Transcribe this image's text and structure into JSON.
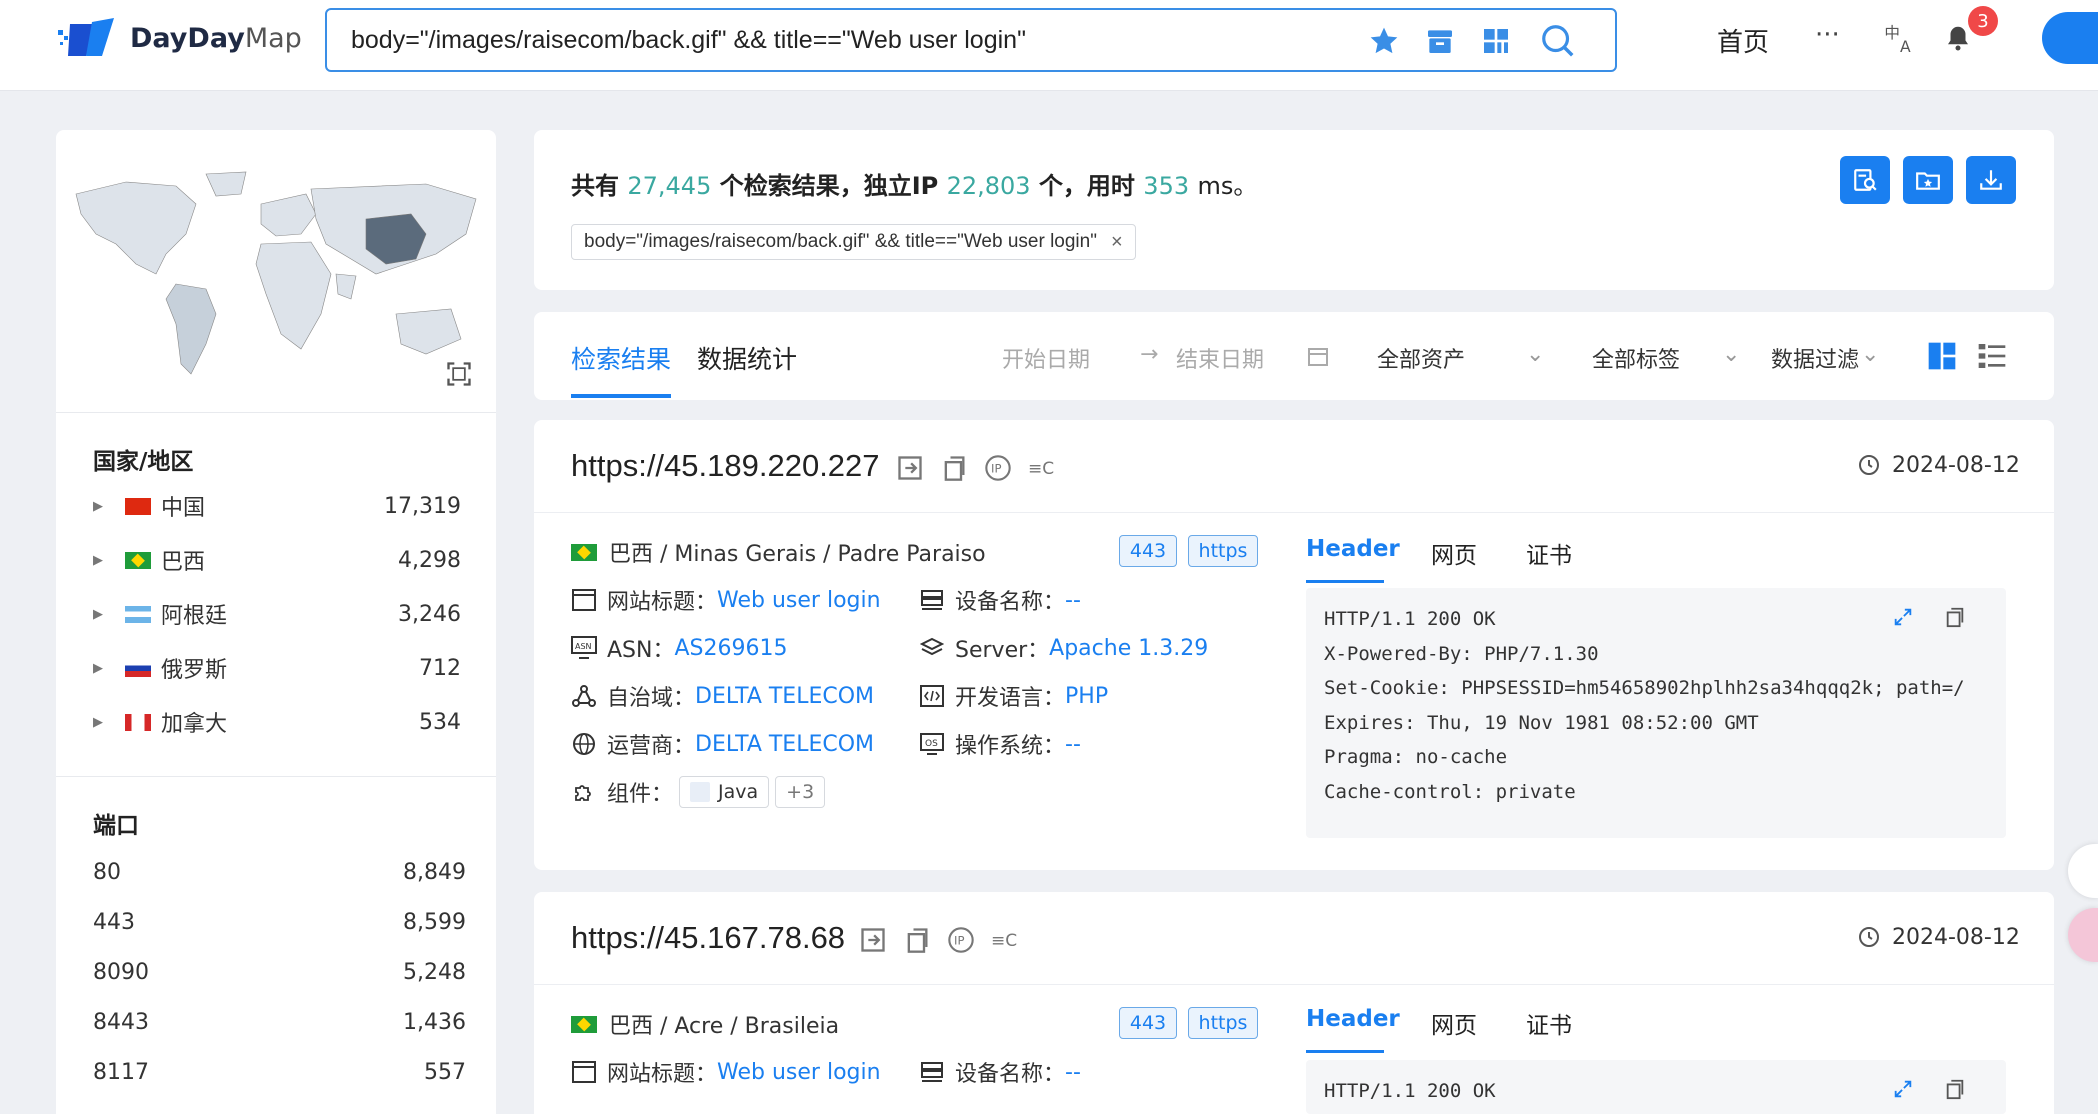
{
  "header": {
    "logo": {
      "bold": "DayDay",
      "light": "Map"
    },
    "search": {
      "value": "body=\"/images/raisecom/back.gif\" && title==\"Web user login\""
    },
    "nav": {
      "home": "首页",
      "more": "···",
      "notifications": "3"
    }
  },
  "colors": {
    "accent": "#1a7ff0",
    "number": "#3aa8a0"
  },
  "sidebar": {
    "country_title": "国家/地区",
    "countries": [
      {
        "name": "中国",
        "count": "17,319",
        "flag": "cn"
      },
      {
        "name": "巴西",
        "count": "4,298",
        "flag": "br"
      },
      {
        "name": "阿根廷",
        "count": "3,246",
        "flag": "ar"
      },
      {
        "name": "俄罗斯",
        "count": "712",
        "flag": "ru"
      },
      {
        "name": "加拿大",
        "count": "534",
        "flag": "ca"
      }
    ],
    "port_title": "端口",
    "ports": [
      {
        "port": "80",
        "count": "8,849"
      },
      {
        "port": "443",
        "count": "8,599"
      },
      {
        "port": "8090",
        "count": "5,248"
      },
      {
        "port": "8443",
        "count": "1,436"
      },
      {
        "port": "8117",
        "count": "557"
      }
    ]
  },
  "summary": {
    "p1": "共有",
    "total": "27,445",
    "p2": "个检索结果，独立IP",
    "ips": "22,803",
    "p3": "个，用时",
    "ms": "353",
    "p4": "ms。",
    "query_tag": "body=\"/images/raisecom/back.gif\" && title==\"Web user login\""
  },
  "tabs": {
    "results": "检索结果",
    "stats": "数据统计",
    "start_date": "开始日期",
    "arrow": "→",
    "end_date": "结束日期",
    "assets": "全部资产",
    "tags": "全部标签",
    "filter": "数据过滤"
  },
  "labels": {
    "site_title": "网站标题：",
    "device": "设备名称：",
    "asn": "ASN：",
    "server": "Server：",
    "as_domain": "自治域：",
    "lang": "开发语言：",
    "isp": "运营商：",
    "os": "操作系统：",
    "components": "组件：",
    "tab_header": "Header",
    "tab_web": "网页",
    "tab_cert": "证书"
  },
  "results": [
    {
      "url": "https://45.189.220.227",
      "date": "2024-08-12",
      "location": "巴西 / Minas Gerais / Padre Paraiso",
      "port": "443",
      "protocol": "https",
      "site_title": "Web user login",
      "device": "--",
      "asn": "AS269615",
      "server": "Apache 1.3.29",
      "as_domain": "DELTA TELECOM",
      "lang": "PHP",
      "isp": "DELTA TELECOM",
      "os": "--",
      "component": "Java",
      "component_more": "+3",
      "header_text": "HTTP/1.1 200 OK\nX-Powered-By: PHP/7.1.30\nSet-Cookie: PHPSESSID=hm54658902hplhh2sa34hqqq2k; path=/\nExpires: Thu, 19 Nov 1981 08:52:00 GMT\nPragma: no-cache\nCache-control: private"
    },
    {
      "url": "https://45.167.78.68",
      "date": "2024-08-12",
      "location": "巴西 / Acre / Brasileia",
      "port": "443",
      "protocol": "https",
      "site_title": "Web user login",
      "device": "--",
      "header_text": "HTTP/1.1 200 OK"
    }
  ]
}
